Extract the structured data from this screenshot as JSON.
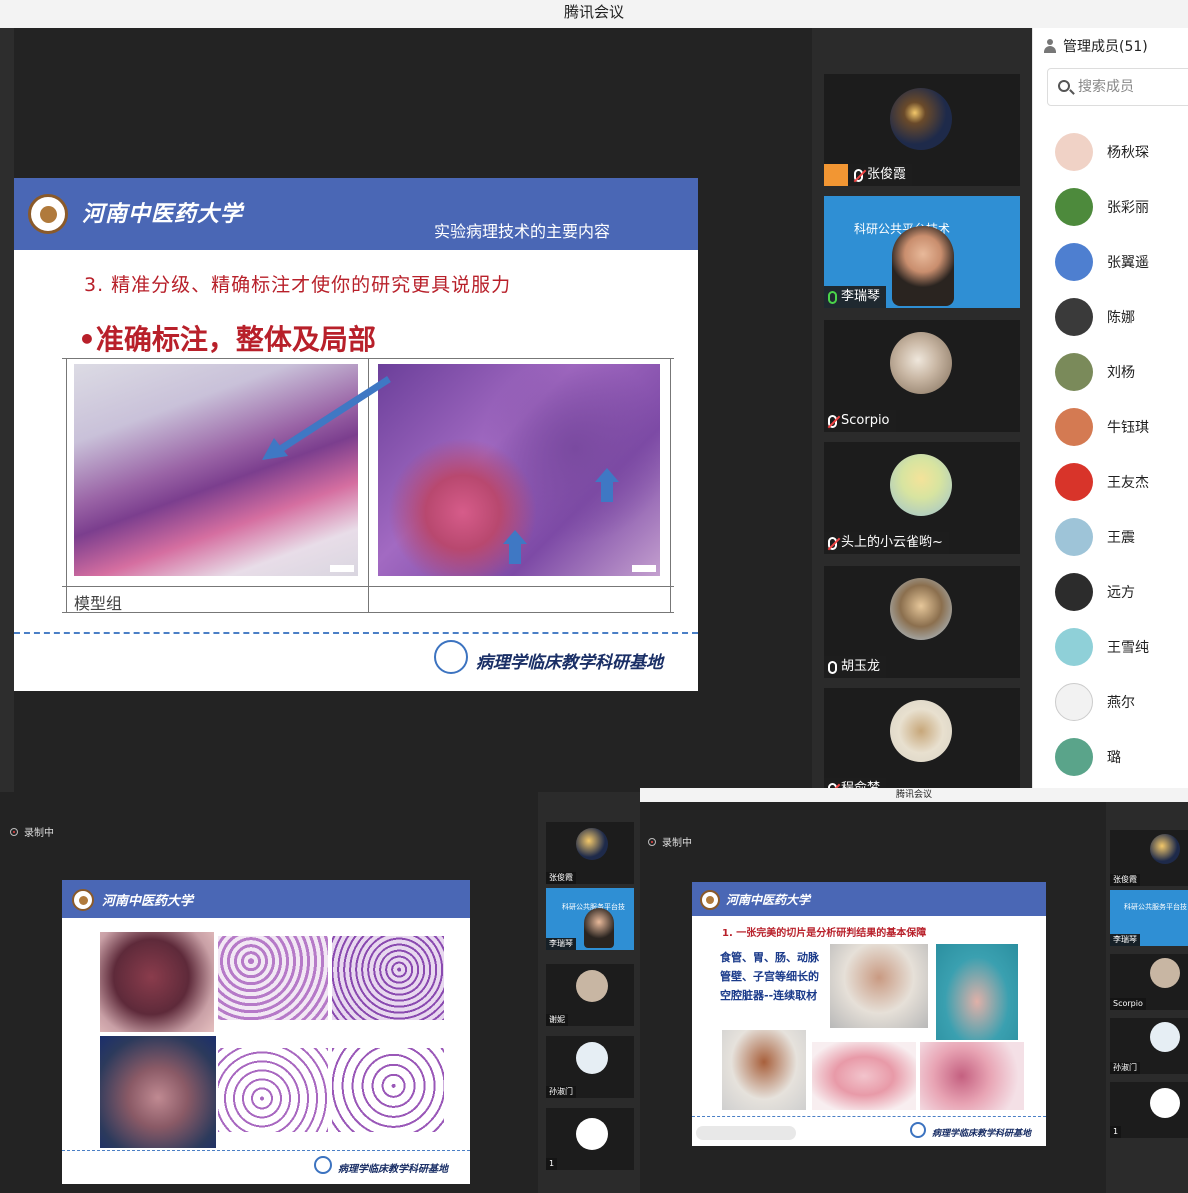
{
  "window": {
    "title": "腾讯会议"
  },
  "slide_main": {
    "university": "河南中医药大学",
    "subtitle": "实验病理技术的主要内容",
    "heading": "3. 精准分级、精确标注才使你的研究更具说服力",
    "bullet": "•准确标注，整体及局部",
    "table_label": "模型组",
    "footer": "病理学临床教学科研基地"
  },
  "video_tiles": [
    {
      "name": "张俊霞",
      "mic": "muted",
      "host": true,
      "avatar_color": "#1e2a4a"
    },
    {
      "name": "李瑞琴",
      "mic": "on",
      "host": false,
      "overlay_text": "科研公共平台技术"
    },
    {
      "name": "Scorpio",
      "mic": "muted",
      "host": false,
      "avatar_color": "#c8b6a3"
    },
    {
      "name": "头上的小云雀哟~",
      "mic": "muted",
      "host": false,
      "avatar_color": "#d7e4a0"
    },
    {
      "name": "胡玉龙",
      "mic": "on",
      "host": false,
      "avatar_color": "#8b6f4e"
    },
    {
      "name": "程俞梦",
      "mic": "muted",
      "host": false,
      "avatar_color": "#e8e0cf"
    }
  ],
  "members": {
    "header": "管理成员(51)",
    "search_placeholder": "搜索成员",
    "list": [
      {
        "name": "杨秋琛",
        "color": "#f0d2c6"
      },
      {
        "name": "张彩丽",
        "color": "#4d8a3c"
      },
      {
        "name": "张翼遥",
        "color": "#4e7fd0"
      },
      {
        "name": "陈娜",
        "color": "#3a3a3a"
      },
      {
        "name": "刘杨",
        "color": "#7a8a5a"
      },
      {
        "name": "牛钰琪",
        "color": "#d47a52"
      },
      {
        "name": "王友杰",
        "color": "#d8342a"
      },
      {
        "name": "王震",
        "color": "#9ec4d8"
      },
      {
        "name": "远方",
        "color": "#2c2c2c"
      },
      {
        "name": "王雪纯",
        "color": "#8fd0d8"
      },
      {
        "name": "燕尔",
        "color": "#f2f2f2"
      },
      {
        "name": "璐",
        "color": "#5aa48a"
      }
    ]
  },
  "shot_left": {
    "recording": "录制中",
    "university": "河南中医药大学",
    "footer": "病理学临床教学科研基地",
    "tiles": [
      {
        "name": "张俊霞"
      },
      {
        "name": "李瑞琴",
        "overlay_text": "科研公共服务平台技"
      },
      {
        "name": "谢妮"
      },
      {
        "name": "孙淑门"
      },
      {
        "name": "1"
      }
    ]
  },
  "shot_right": {
    "title": "腾讯会议",
    "recording": "录制中",
    "university": "河南中医药大学",
    "heading": "1. 一张完美的切片是分析研判结果的基本保障",
    "body_text": "食管、胃、肠、动脉管壁、子宫等细长的空腔脏器--连续取材",
    "footer": "病理学临床教学科研基地",
    "tiles": [
      {
        "name": "张俊霞"
      },
      {
        "name": "李瑞琴",
        "overlay_text": "科研公共服务平台技"
      },
      {
        "name": "Scorpio"
      },
      {
        "name": "孙淑门"
      },
      {
        "name": "1"
      }
    ]
  }
}
